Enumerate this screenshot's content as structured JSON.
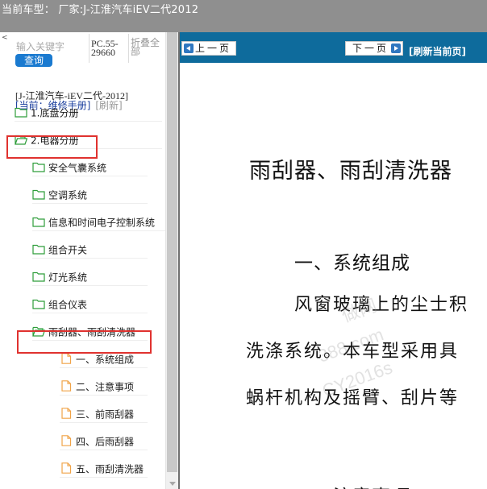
{
  "header": {
    "text": "当前车型：  厂家:J-江淮汽车iEV二代2012"
  },
  "search": {
    "placeholder": "输入关键字",
    "button_label": "查询",
    "code": "PC.55-29660",
    "collapse_label": "折叠全部",
    "left_marker": "<"
  },
  "breadcrumb": {
    "vehicle": "[J-江淮汽车-iEV二代-2012]",
    "current": "[当前：维修手册]",
    "refresh": "[刷新]"
  },
  "tree": [
    {
      "label": "1.底盘分册",
      "icon": "folder-closed-icon"
    },
    {
      "label": "2.电器分册",
      "icon": "folder-open-icon"
    },
    {
      "label": "安全气囊系统",
      "icon": "folder-closed-icon"
    },
    {
      "label": "空调系统",
      "icon": "folder-closed-icon"
    },
    {
      "label": "信息和时间电子控制系统",
      "icon": "folder-closed-icon"
    },
    {
      "label": "组合开关",
      "icon": "folder-closed-icon"
    },
    {
      "label": "灯光系统",
      "icon": "folder-closed-icon"
    },
    {
      "label": "组合仪表",
      "icon": "folder-closed-icon"
    },
    {
      "label": "雨刮器、雨刮清洗器",
      "icon": "folder-open-icon"
    },
    {
      "label": "一、系统组成",
      "icon": "document-icon"
    },
    {
      "label": "二、注意事项",
      "icon": "document-icon"
    },
    {
      "label": "三、前雨刮器",
      "icon": "document-icon"
    },
    {
      "label": "四、后雨刮器",
      "icon": "document-icon"
    },
    {
      "label": "五、雨刮清洗器",
      "icon": "document-icon"
    }
  ],
  "toolbar": {
    "prev_label": "上一页",
    "next_label": "下一页",
    "refresh_label": "[刷新当前页]"
  },
  "document": {
    "title": "雨刮器、雨刮清洗器",
    "section1": "一、系统组成",
    "para_line1": "风窗玻璃上的尘士积",
    "para_line2": "洗涤系统。本车型采用具",
    "para_line3": "蜗杆机构及摇臂、刮片等",
    "section2": "二、注意事项"
  },
  "watermark": {
    "line1": "做网",
    "line2": "388.com",
    "line3": "CY2016s"
  },
  "colors": {
    "topbar": "#8f8f8f",
    "navbar": "#0e6b9c",
    "query_button": "#1a7ad0",
    "highlight_box": "#e0322f",
    "folder_icon": "#2e9d3a",
    "document_icon": "#f0a347"
  }
}
